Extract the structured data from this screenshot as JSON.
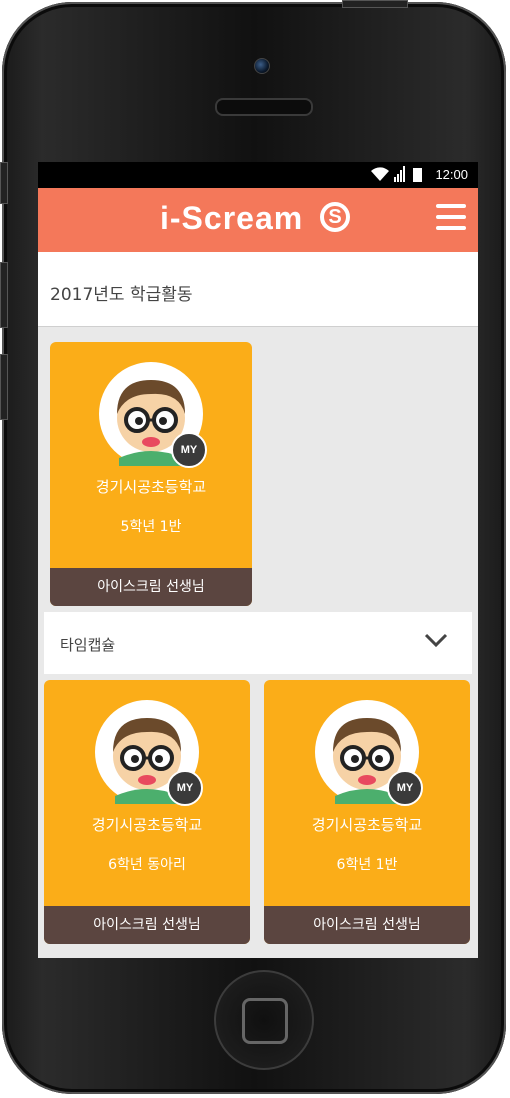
{
  "status_bar": {
    "time": "12:00"
  },
  "app_bar": {
    "logo_text": "i-Scream",
    "logo_mark": "S"
  },
  "section": {
    "title": "2017년도 학급활동"
  },
  "cards_top": [
    {
      "school": "경기시공초등학교",
      "class_name": "5학년 1반",
      "teacher": "아이스크림 선생님",
      "badge": "MY"
    }
  ],
  "dropdown": {
    "label": "타임캡슐"
  },
  "cards_bottom": [
    {
      "school": "경기시공초등학교",
      "class_name": "6학년 동아리",
      "teacher": "아이스크림 선생님",
      "badge": "MY"
    },
    {
      "school": "경기시공초등학교",
      "class_name": "6학년 1반",
      "teacher": "아이스크림 선생님",
      "badge": "MY"
    }
  ],
  "colors": {
    "app_bar": "#f4785a",
    "card": "#fbad18",
    "card_footer": "#5b4540"
  }
}
